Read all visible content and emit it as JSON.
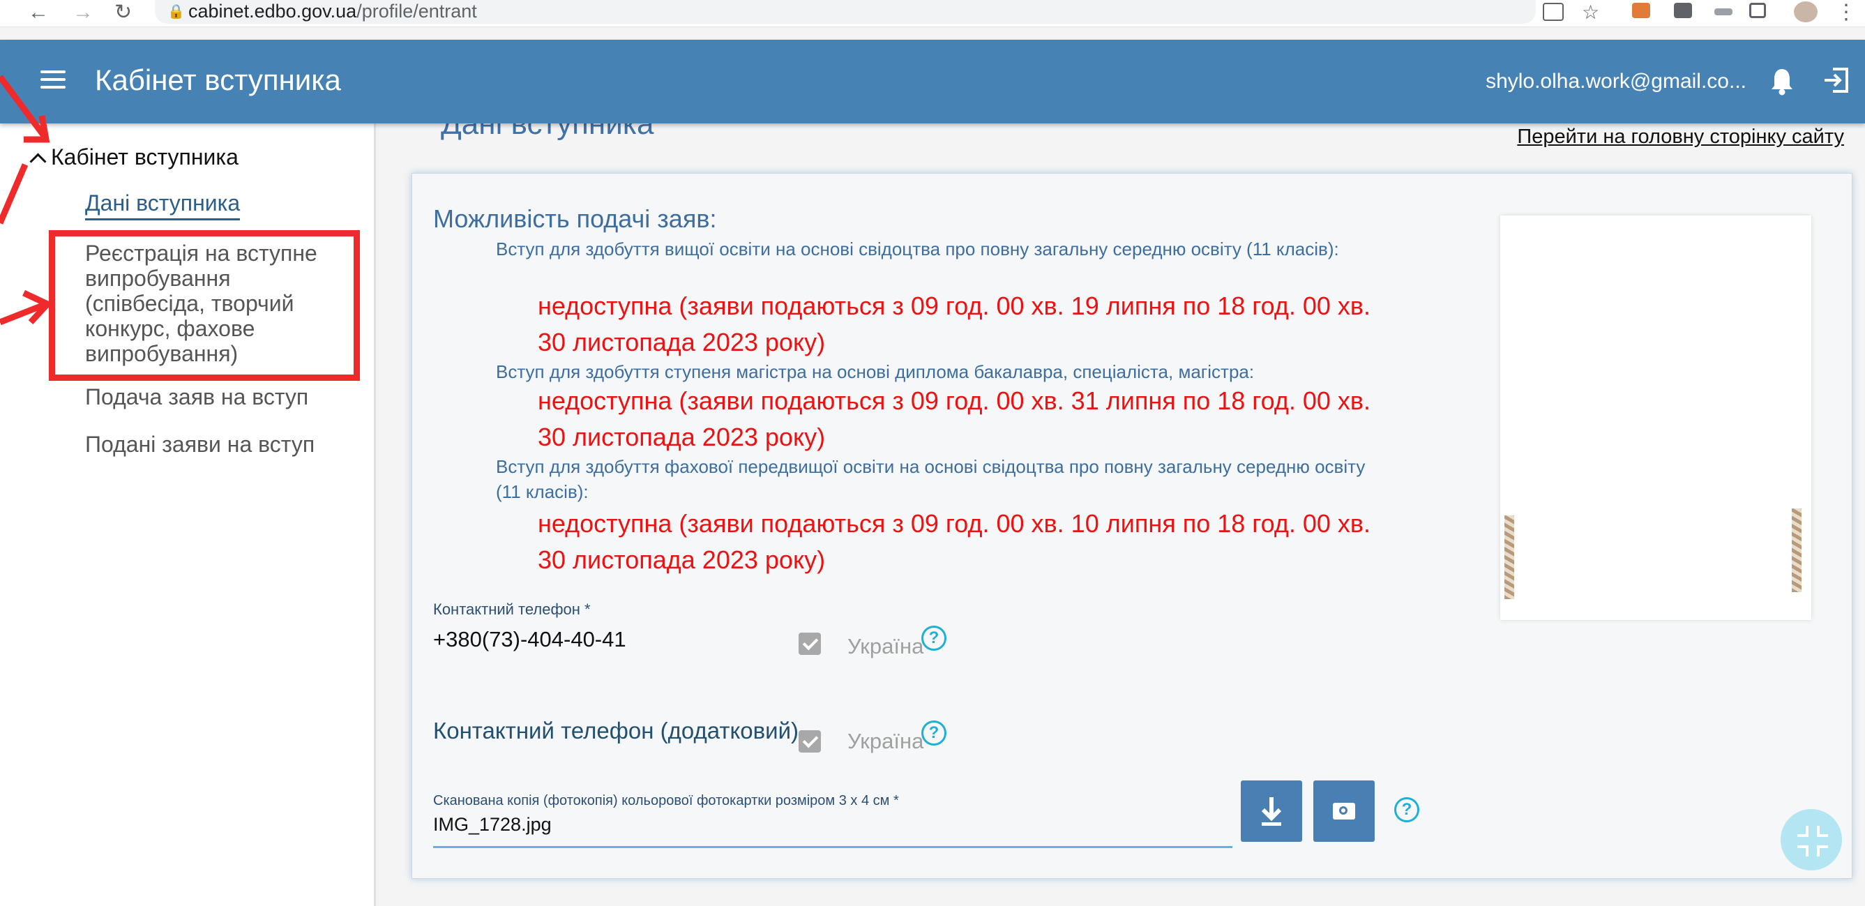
{
  "browser": {
    "url_host": "cabinet.edbo.gov.ua",
    "url_path": "/profile/entrant"
  },
  "appbar": {
    "title": "Кабінет вступника",
    "user_email": "shylo.olha.work@gmail.co..."
  },
  "sidebar": {
    "section": "Кабінет вступника",
    "items": [
      {
        "label": "Дані вступника",
        "active": true
      },
      {
        "label": "Реєстрація на вступне випробування (співбесіда, творчий конкурс, фахове випробування)"
      },
      {
        "label": "Подача заяв на вступ"
      },
      {
        "label": "Подані заяви на вступ"
      }
    ]
  },
  "main": {
    "title": "Дані вступника",
    "home_link": "Перейти на головну сторінку сайту",
    "admission_heading": "Можливість подачі заяв:",
    "admissions": [
      {
        "label": "Вступ для здобуття вищої освіти на основі свідоцтва про повну загальну середню освіту (11 класів):",
        "status": "недоступна (заяви подаються з 09 год. 00 хв. 19 липня по 18 год. 00 хв. 30 листопада 2023 року)"
      },
      {
        "label": "Вступ для здобуття ступеня магістра на основі диплома бакалавра, спеціаліста, магістра:",
        "status": "недоступна (заяви подаються з 09 год. 00 хв. 31 липня по 18 год. 00 хв. 30 листопада 2023 року)"
      },
      {
        "label": "Вступ для здобуття фахової передвищої освіти на основі свідоцтва про повну загальну середню освіту (11 класів):",
        "status": "недоступна (заяви подаються з 09 год. 00 хв. 10 липня по 18 год. 00 хв. 30 листопада 2023 року)"
      }
    ],
    "phone_label": "Контактний телефон *",
    "phone_value": "+380(73)-404-40-41",
    "country": "Україна",
    "phone2_label": "Контактний телефон (додатковий)",
    "photo_label": "Сканована копія (фотокопія) кольорової фотокартки розміром 3 х 4 см *",
    "photo_file": "IMG_1728.jpg"
  },
  "colors": {
    "appbar": "#4682b4",
    "status_red": "#ee1111",
    "annotation_red": "#ee2a2a",
    "help_cyan": "#1fb0d8"
  }
}
